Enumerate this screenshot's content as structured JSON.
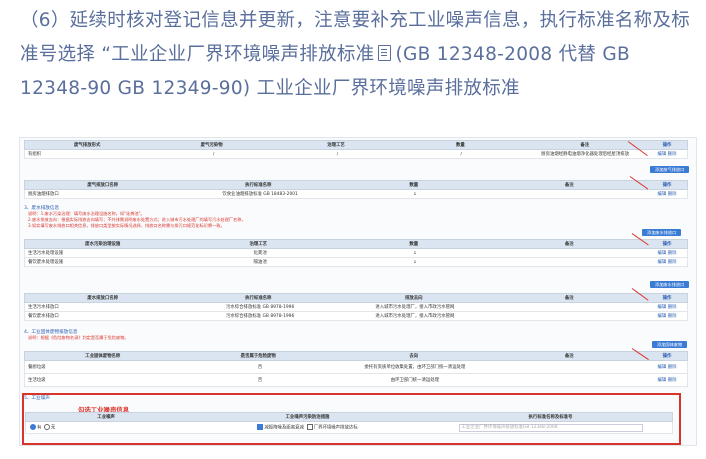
{
  "intro": {
    "line1": "（6）延续时核对登记信息并更新，注意要补充工业噪声信息，执行标准名称及标",
    "line2a": "准号选择 “工业企业厂界环境噪声排放标准",
    "line2b": "(GB 12348-2008 代替 GB",
    "line3": "12348-90 GB 12349-90) 工业企业厂界环境噪声排放标准"
  },
  "screenshot": {
    "sec1": {
      "headers": [
        "废气排放形式",
        "废气污染物",
        "治理工艺",
        "数量",
        "备注",
        "操作"
      ],
      "row": [
        "有组织",
        "/",
        "/",
        "/",
        "厨房油烟经静电油烟净化器处理后经屋顶排放",
        "编辑 删除"
      ],
      "button": "添加废气排放口"
    },
    "sec2": {
      "headers": [
        "废气排放口名称",
        "执行标准名称",
        "数量",
        "备注",
        "操作"
      ],
      "row": [
        "厨房油烟排放口",
        "饮食业油烟排放标准 GB 18483-2001",
        "1",
        "",
        "编辑 删除"
      ]
    },
    "sec3": {
      "title": "3、废水排放信息",
      "notes": [
        "说明：1.废水污染治理：填写废水治理设施名称，如\"化粪池\"。",
        "2.废水排放去向：根据实际排放去向填写；不外排需说明废水处置方式；进入城市污水处理厂的填写污水处理厂名称。",
        "3.如实填写废水排放口相关信息，排放口类型按实际情况选择，排放口名称需与排污口规范化标识牌一致。"
      ],
      "button": "添加废水排放口",
      "headers": [
        "废水污染治理设施",
        "治理工艺",
        "数量",
        "备注",
        "操作"
      ],
      "rows": [
        [
          "生活污水处理设施",
          "化粪池",
          "1",
          "",
          "编辑 删除"
        ],
        [
          "餐饮废水处理设施",
          "隔油池",
          "1",
          "",
          "编辑 删除"
        ]
      ]
    },
    "sec4": {
      "button": "添加废水排放口",
      "headers": [
        "废水排放口名称",
        "执行标准名称",
        "排放去向",
        "备注",
        "操作"
      ],
      "rows": [
        [
          "生活污水排放口",
          "污水综合排放标准 GB 8978-1996",
          "进入城市污水处理厂，接入市政污水管网",
          "",
          "编辑 删除"
        ],
        [
          "餐饮废水排放口",
          "污水综合排放标准 GB 8978-1996",
          "进入城市污水处理厂，接入市政污水管网",
          "",
          "编辑 删除"
        ]
      ]
    },
    "sec5": {
      "title": "4、工业固体废物排放信息",
      "note": "说明：根据《危险废物名录》判定是否属于危险废物。",
      "button": "添加固体废物",
      "headers": [
        "工业固体废物名称",
        "是否属于危险废物",
        "去向",
        "备注",
        "操作"
      ],
      "rows": [
        [
          "餐厨垃圾",
          "否",
          "委托有资质单位收集处置，由环卫部门统一清运处理",
          "",
          "编辑 删除"
        ],
        [
          "生活垃圾",
          "否",
          "由环卫部门统一清运处理",
          "",
          "编辑 删除"
        ]
      ]
    },
    "sec6": {
      "title": "5、工业噪声",
      "label": "勾选工业噪声信息",
      "headers": [
        "工业噪声",
        "工业噪声污染防治措施",
        "执行标准名称及标准号"
      ],
      "radio_yes": "有",
      "radio_no": "无",
      "measure1": "减振降噪及距离衰减",
      "measure2": "厂界环境噪声排放达标",
      "standard": "工业企业厂界环境噪声排放标准GB 12348-2008"
    }
  },
  "colors": {
    "intro_text": "#5a6f9c",
    "accent_blue": "#3a7bd5",
    "highlight_red": "#d9342b",
    "table_header_bg": "#dbe5f1"
  },
  "icons": {
    "doc": "document-icon"
  }
}
